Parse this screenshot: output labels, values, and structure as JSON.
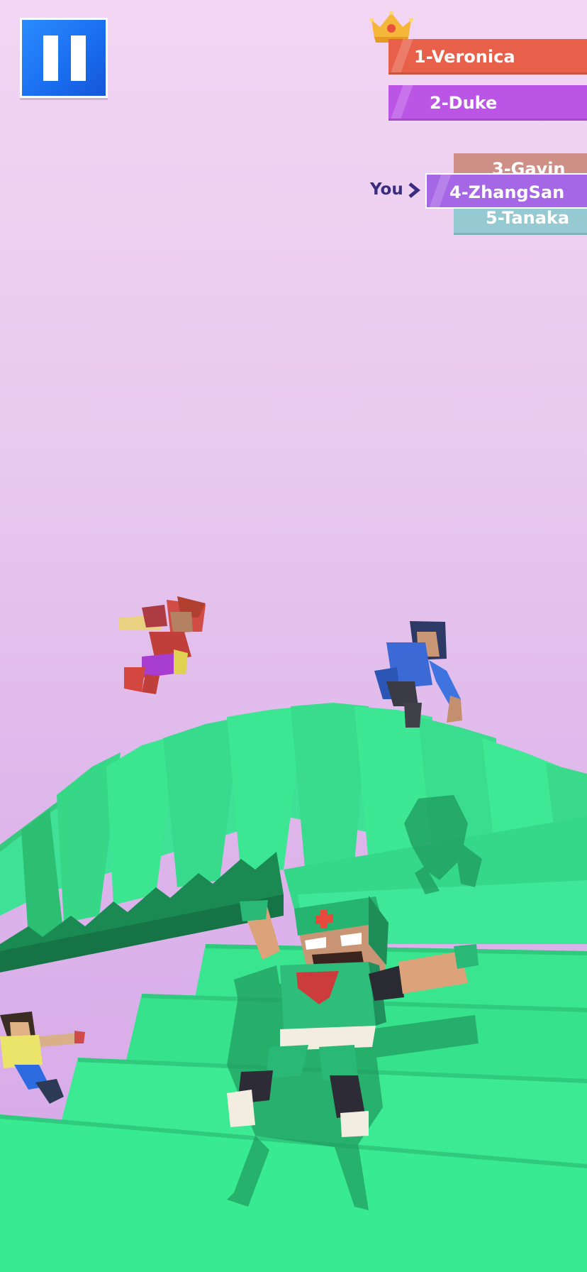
{
  "hud": {
    "pause_icon": "pause-icon",
    "crown_icon": "crown-icon",
    "you_label": "You",
    "you_marker_icon": "chevron-right-icon"
  },
  "leaderboard": [
    {
      "label": "1-Veronica",
      "color": "#e8604a"
    },
    {
      "label": "2-Duke",
      "color": "#bb55e6"
    },
    {
      "label": "3-Gavin",
      "color": "#cd8f86"
    },
    {
      "label": "4-ZhangSan",
      "color": "#a667e6"
    },
    {
      "label": "5-Tanaka",
      "color": "#95cad3"
    }
  ],
  "colors": {
    "sky_top": "#f2d6f3",
    "sky_bottom": "#d6a8e8",
    "stairs": "#36e891",
    "pause_button": "#1a6ff0",
    "you_text": "#3a2d80"
  }
}
